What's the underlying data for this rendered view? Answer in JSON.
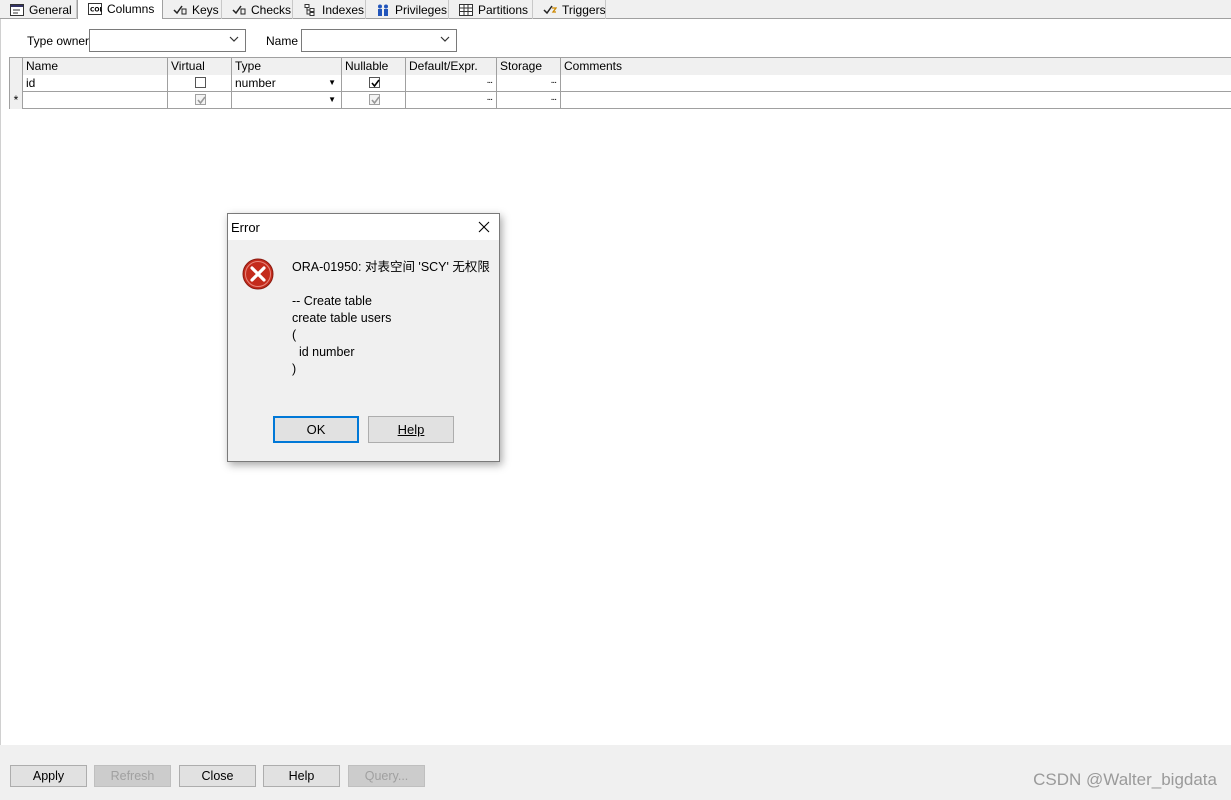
{
  "tabs": [
    {
      "label": "General",
      "icon": "general-icon"
    },
    {
      "label": "Columns",
      "icon": "col-icon",
      "active": true
    },
    {
      "label": "Keys",
      "icon": "key-icon"
    },
    {
      "label": "Checks",
      "icon": "check-icon"
    },
    {
      "label": "Indexes",
      "icon": "index-icon"
    },
    {
      "label": "Privileges",
      "icon": "users-icon"
    },
    {
      "label": "Partitions",
      "icon": "table-icon"
    },
    {
      "label": "Triggers",
      "icon": "trigger-icon"
    }
  ],
  "filters": {
    "type_owner_label": "Type owner",
    "type_owner_value": "",
    "name_label": "Name",
    "name_value": ""
  },
  "grid": {
    "columns": [
      "Name",
      "Virtual",
      "Type",
      "Nullable",
      "Default/Expr.",
      "Storage",
      "Comments"
    ],
    "rows": [
      {
        "indicator": "",
        "name": "id",
        "virtual": false,
        "type": "number",
        "nullable": true,
        "default": "",
        "storage": "",
        "comments": ""
      },
      {
        "indicator": "*",
        "name": "",
        "virtual": true,
        "type": "",
        "nullable": true,
        "default": "",
        "storage": "",
        "comments": ""
      }
    ],
    "ellipsis": "..."
  },
  "dialog": {
    "title": "Error",
    "message": "ORA-01950: 对表空间 'SCY' 无权限\n\n-- Create table\ncreate table users\n(\n  id number\n)",
    "ok_label": "OK",
    "help_label": "Help"
  },
  "buttons": {
    "apply": "Apply",
    "refresh": "Refresh",
    "close": "Close",
    "help": "Help",
    "query": "Query..."
  },
  "watermark": "CSDN @Walter_bigdata"
}
